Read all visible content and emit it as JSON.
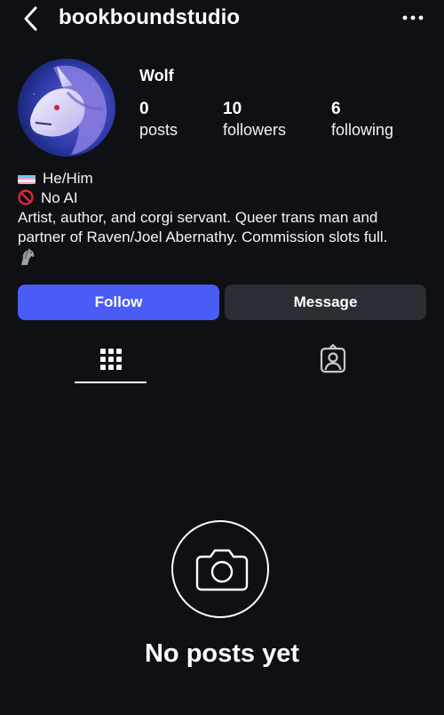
{
  "header": {
    "username": "bookboundstudio",
    "back_icon": "chevron-left-icon",
    "more_icon": "more-horizontal-icon"
  },
  "profile": {
    "display_name": "Wolf",
    "stats": [
      {
        "value": "0",
        "label": "posts"
      },
      {
        "value": "10",
        "label": "followers"
      },
      {
        "value": "6",
        "label": "following"
      }
    ]
  },
  "bio": {
    "pronouns": "He/Him",
    "no_ai": "No AI",
    "description": "Artist, author, and corgi servant. Queer trans man and partner of Raven/Joel Abernathy. Commission slots full.",
    "line1": "Artist, author, and corgi servant. Queer trans man and",
    "line2": "partner of Raven/Joel Abernathy. Commission slots full."
  },
  "actions": {
    "follow_label": "Follow",
    "message_label": "Message",
    "follow_color": "#4a5cf5",
    "message_color": "#2a2d33"
  },
  "tabs": [
    {
      "icon": "grid-icon",
      "active": true
    },
    {
      "icon": "tagged-person-icon",
      "active": false
    }
  ],
  "empty_state": {
    "icon": "camera-icon",
    "text": "No posts yet"
  }
}
